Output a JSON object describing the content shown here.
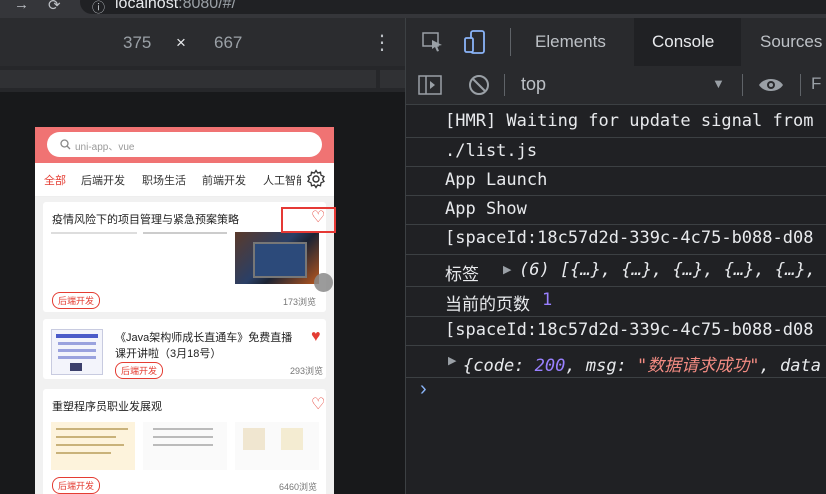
{
  "browser": {
    "back_glyph": "→",
    "reload_glyph": "⟳",
    "url_host": "localhost",
    "url_rest": ":8080/#/"
  },
  "device": {
    "width": "375",
    "times": "×",
    "height": "667"
  },
  "app": {
    "search_placeholder": "uni-app、vue",
    "tabs": [
      "全部",
      "后端开发",
      "职场生活",
      "前端开发",
      "人工智能"
    ],
    "accent": "#e43d33",
    "cards": [
      {
        "title": "疫情风险下的项目管理与紧急预案策略",
        "tag": "后端开发",
        "views": "173浏览"
      },
      {
        "title": "《Java架构师成长直通车》免费直播课开讲啦（3月18号）",
        "tag": "后端开发",
        "views": "293浏览"
      },
      {
        "title": "重塑程序员职业发展观",
        "tag": "后端开发",
        "views": "6460浏览"
      }
    ]
  },
  "devtools": {
    "tabs": {
      "elements": "Elements",
      "console": "Console",
      "sources": "Sources"
    },
    "context": "top",
    "logs": {
      "hmr": "[HMR] Waiting for update signal from",
      "list": "./list.js",
      "launch": "App Launch",
      "show": "App Show",
      "space1": "[spaceId:18c57d2d-339c-4c75-b088-d08",
      "tags_label": "标签",
      "tags_value": "(6) [{…}, {…}, {…}, {…}, {…},",
      "page_label": "当前的页数",
      "page_value": "1",
      "space2": "[spaceId:18c57d2d-339c-4c75-b088-d08",
      "obj_start": "{code: ",
      "obj_code": "200",
      "obj_mid": ", msg: ",
      "obj_msg": "\"数据请求成功\"",
      "obj_end": ", data"
    },
    "prompt": "›"
  }
}
